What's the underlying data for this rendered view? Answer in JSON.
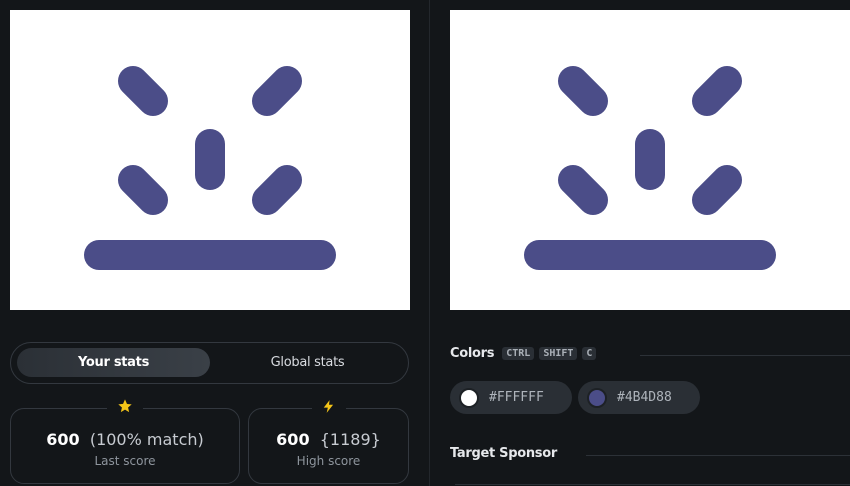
{
  "canvas": {
    "background": "#FFFFFF",
    "foreground": "#4B4D88"
  },
  "stats": {
    "tabs": {
      "your": "Your stats",
      "global": "Global stats"
    },
    "last": {
      "icon": "star-icon",
      "value": "600",
      "detail": "(100% match)",
      "label": "Last score"
    },
    "high": {
      "icon": "lightning-icon",
      "value": "600",
      "detail": "{1189}",
      "label": "High score"
    }
  },
  "colors_section": {
    "title": "Colors",
    "shortcut": [
      "CTRL",
      "SHIFT",
      "C"
    ],
    "swatches": [
      {
        "hex": "#FFFFFF",
        "color": "#FFFFFF"
      },
      {
        "hex": "#4B4D88",
        "color": "#4B4D88"
      }
    ]
  },
  "sponsor_section": {
    "title": "Target Sponsor"
  }
}
